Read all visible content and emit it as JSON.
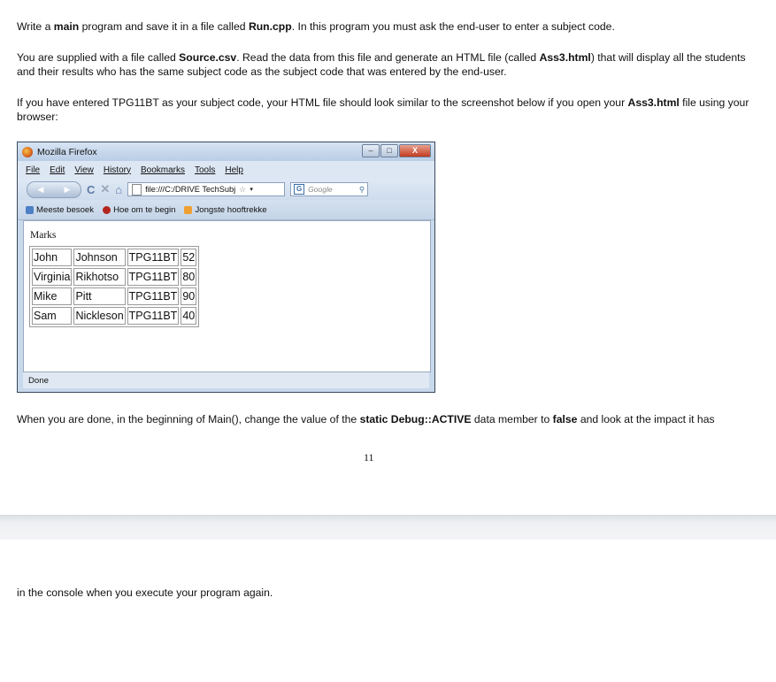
{
  "page1": {
    "p1": [
      "Write a ",
      "main",
      " program and save it in a file called ",
      "Run.cpp",
      ". In this program you must ask the end-user to enter a subject code."
    ],
    "p2": [
      "You are supplied with a file called ",
      "Source.csv",
      ". Read the data from this file and generate an HTML file (called ",
      "Ass3.html",
      ") that will display all the students and their results who has the same subject code as the subject code that was entered by the end-user."
    ],
    "p3": [
      "If you have entered TPG11BT as your subject code, your HTML file should look similar to the screenshot below if you open your ",
      "Ass3.html",
      " file using your browser:"
    ],
    "p4": [
      "When you are done, in the beginning of Main(), change the value of the ",
      "static Debug::ACTIVE",
      " data member to ",
      "false",
      " and look at the impact it has"
    ],
    "page_number": "11"
  },
  "page2": {
    "p1": "in the console when you execute your program again."
  },
  "browser": {
    "title": "Mozilla Firefox",
    "menu": [
      "File",
      "Edit",
      "View",
      "History",
      "Bookmarks",
      "Tools",
      "Help"
    ],
    "url": "file:///C:/DRIVE TechSubj",
    "search_placeholder": "Google",
    "bookmarks": [
      "Meeste besoek",
      "Hoe om te begin",
      "Jongste hooftrekke"
    ],
    "content_heading": "Marks",
    "rows": [
      [
        "John",
        "Johnson",
        "TPG11BT",
        "52"
      ],
      [
        "Virginia",
        "Rikhotso",
        "TPG11BT",
        "80"
      ],
      [
        "Mike",
        "Pitt",
        "TPG11BT",
        "90"
      ],
      [
        "Sam",
        "Nickleson",
        "TPG11BT",
        "40"
      ]
    ],
    "status": "Done"
  },
  "colors": {
    "window_frame": "#3a4a5c",
    "titlebar": "#c9d9ec",
    "close_button": "#c23b22"
  }
}
